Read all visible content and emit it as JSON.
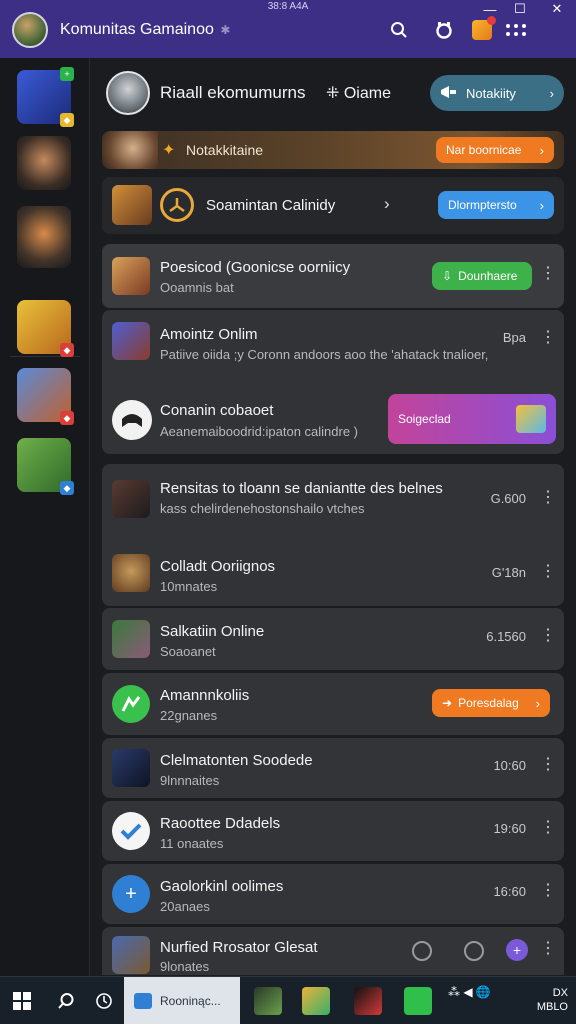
{
  "system": {
    "time": "38:8 A4A"
  },
  "titlebar": {
    "title": "Komunitas Gamainoo",
    "pin": "✱",
    "icons": [
      "search-icon",
      "headset-icon",
      "gift-icon",
      "grid-icon"
    ],
    "window_controls": [
      "—",
      "☐",
      "✕"
    ]
  },
  "header": {
    "title": "Riaall ekomumurns",
    "online": "⁜ Oiame",
    "button_label": "Notakiity",
    "button_color": "#3b6f86"
  },
  "banner": {
    "label": "Notakkitaine",
    "button_label": "Nar boornicae"
  },
  "community": {
    "label": "Soamintan Calinidy",
    "arrow": "›",
    "button_label": "Dlormptersto"
  },
  "group_card": [
    {
      "title": "Poesicod (Goonicse oorniicy",
      "sub": "Ooamnis bat",
      "button_label": "Dounhaere",
      "button_color": "#3db24a"
    },
    {
      "title": "Amointz Onlim",
      "sub": "Patiive oiida ;y Coronn andoors aoo the 'ahatack tnalioer,",
      "time": "Bpa"
    },
    {
      "title": "Conanin cobaoet",
      "sub": "Aeanemaiboodrid:ipaton calindre )",
      "button_label": "Soigeclad"
    }
  ],
  "feed": [
    {
      "title": "Rensitas to tloann se daniantte des belnes",
      "sub": "kass chelirdenehostonshailo vtches",
      "time": "G.600"
    },
    {
      "title": "Colladt Ooriignos",
      "sub": "10mnates",
      "time": "G'18n"
    },
    {
      "title": "Salkatiin Online",
      "sub": "Soaoanet",
      "time": "6.1560"
    },
    {
      "title": "Amannnkoliis",
      "sub": "22gnanes",
      "button_label": "Poresdalag",
      "button_color": "#f07a22"
    },
    {
      "title": "Clelmatonten Soodede",
      "sub": "9lnnnaites",
      "time": "10:60"
    },
    {
      "title": "Raoottee Ddadels",
      "sub": "11 onaates",
      "time": "19:60"
    },
    {
      "title": "Gaolorkinl oolimes",
      "sub": "20anaes",
      "time": "16:60"
    },
    {
      "title": "Nurfied Rrosator Glesat",
      "sub": "9lonates"
    }
  ],
  "taskbar": {
    "app_label": "Rooninąc...",
    "tray": "⁂ ◀ 🌐",
    "clock_line1": "DX",
    "clock_line2": "MBLO"
  },
  "colors": {
    "titlebar": "#3d2f86",
    "accent_orange": "#f07a22",
    "accent_blue": "#3b94e6",
    "accent_green": "#3db24a"
  }
}
